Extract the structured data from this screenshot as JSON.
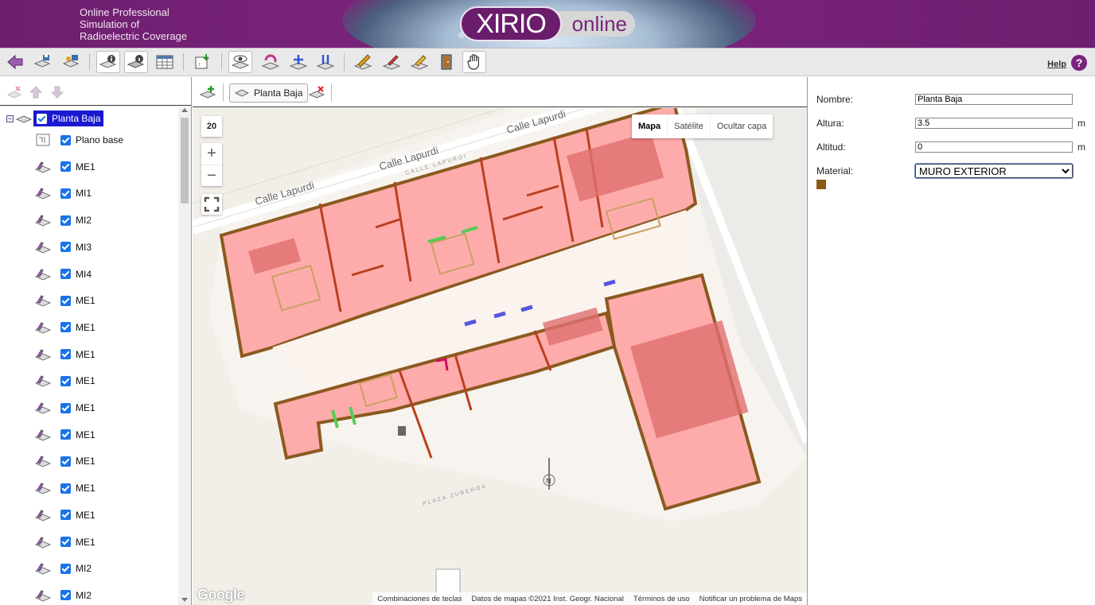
{
  "header": {
    "tagline_lines": [
      "Online Professional",
      "Simulation of",
      "Radioelectric Coverage"
    ],
    "logo_main": "XIRIO",
    "logo_sub": "online",
    "logo_mark": "®"
  },
  "toolbar": {
    "help_label": "Help",
    "help_icon": "?"
  },
  "tree": {
    "root_label": "Planta Baja",
    "items": [
      {
        "label": "Plano base",
        "icon": "base-plan-icon"
      },
      {
        "label": "ME1",
        "icon": "layer-icon"
      },
      {
        "label": "MI1",
        "icon": "layer-icon"
      },
      {
        "label": "MI2",
        "icon": "layer-icon"
      },
      {
        "label": "MI3",
        "icon": "layer-icon"
      },
      {
        "label": "MI4",
        "icon": "layer-icon"
      },
      {
        "label": "ME1",
        "icon": "layer-icon"
      },
      {
        "label": "ME1",
        "icon": "layer-icon"
      },
      {
        "label": "ME1",
        "icon": "layer-icon"
      },
      {
        "label": "ME1",
        "icon": "layer-icon"
      },
      {
        "label": "ME1",
        "icon": "layer-icon"
      },
      {
        "label": "ME1",
        "icon": "layer-icon"
      },
      {
        "label": "ME1",
        "icon": "layer-icon"
      },
      {
        "label": "ME1",
        "icon": "layer-icon"
      },
      {
        "label": "ME1",
        "icon": "layer-icon"
      },
      {
        "label": "ME1",
        "icon": "layer-icon"
      },
      {
        "label": "MI2",
        "icon": "layer-icon"
      },
      {
        "label": "MI2",
        "icon": "layer-icon"
      }
    ]
  },
  "map": {
    "layer_pill_label": "Planta Baja",
    "zoom_level": "20",
    "zoom_in": "+",
    "zoom_out": "−",
    "map_types": [
      "Mapa",
      "Satélite",
      "Ocultar capa"
    ],
    "active_map_type": "Mapa",
    "street_labels": [
      "Calle Lapurdi",
      "Calle Lapurdi",
      "Calle Lapurdi",
      "CALLE LAPURDI",
      "PLAZA ZUBEROA"
    ],
    "google_logo": "Google",
    "attribution": [
      "Combinaciones de teclas",
      "Datos de mapas ©2021 Inst. Geogr. Nacional",
      "Términos de uso",
      "Notificar un problema de Maps"
    ],
    "wall_color": "#8b5a1f",
    "room_fill": "#ff9c9c"
  },
  "properties": {
    "name_label": "Nombre:",
    "name_value": "Planta Baja",
    "height_label": "Altura:",
    "height_value": "3.5",
    "height_unit": "m",
    "altitude_label": "Altitud:",
    "altitude_value": "0",
    "altitude_unit": "m",
    "material_label": "Material:",
    "material_value": "MURO EXTERIOR",
    "material_color": "#8b5a14"
  }
}
